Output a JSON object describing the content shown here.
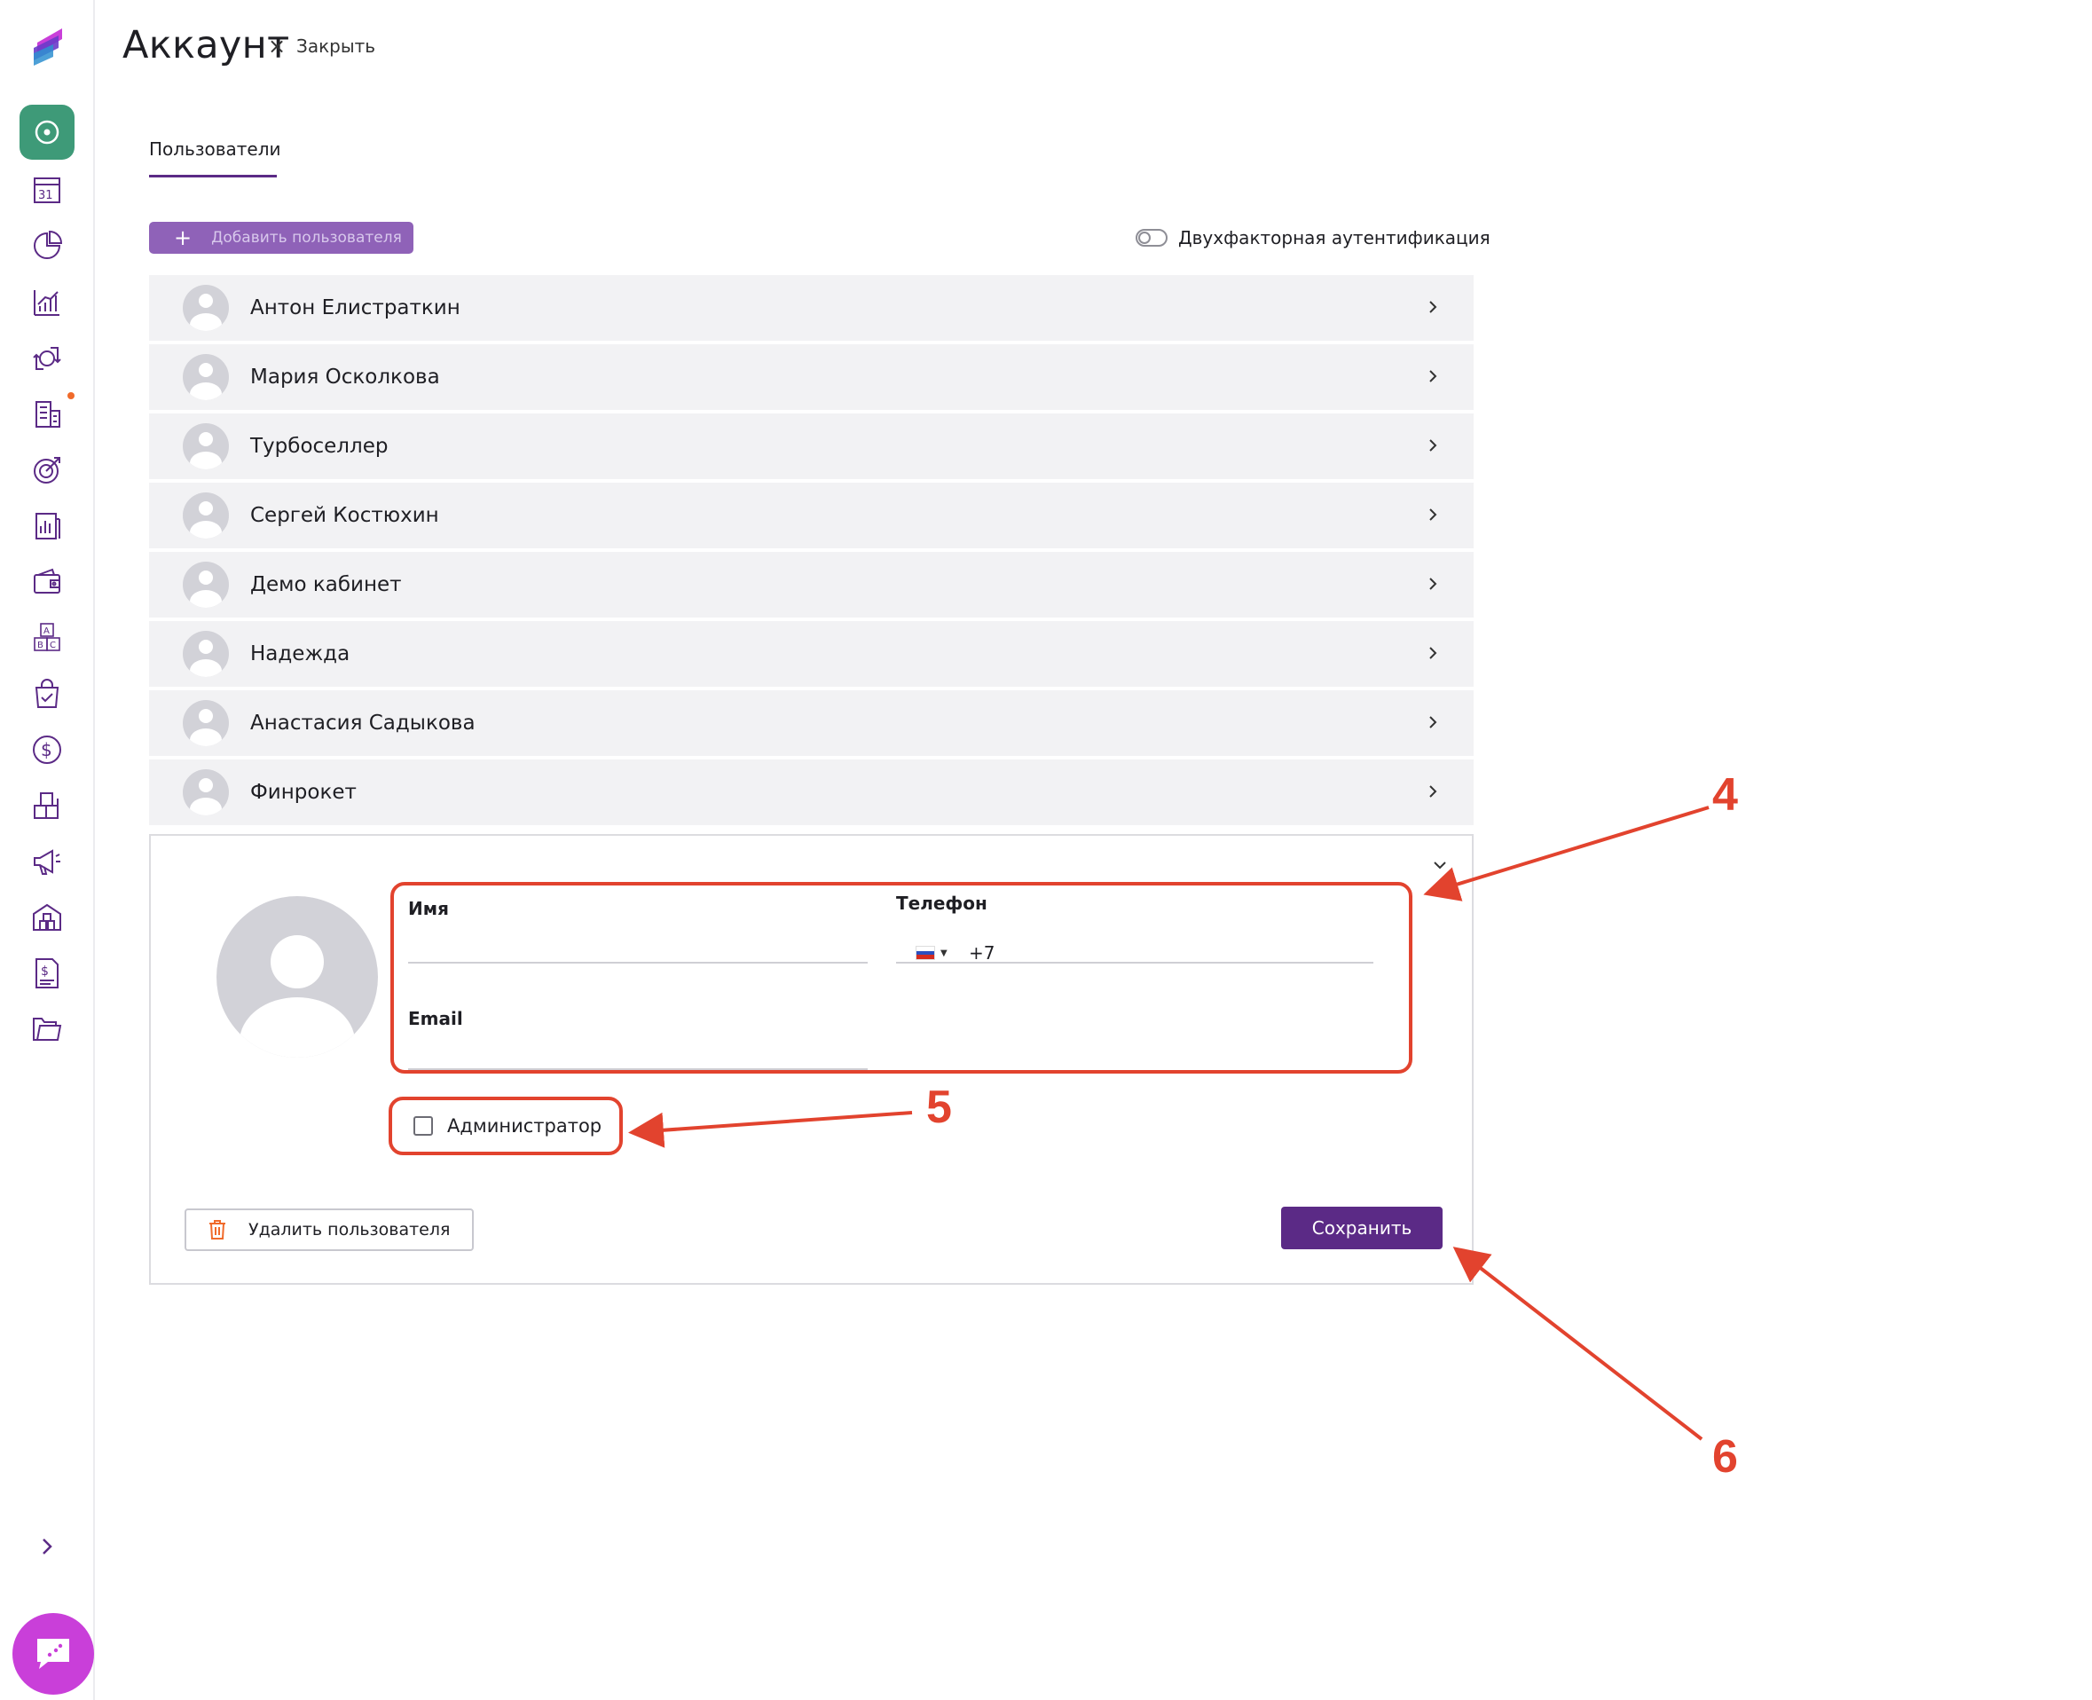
{
  "header": {
    "title": "Аккаунт",
    "close_icon": "×",
    "close_label": "Закрыть"
  },
  "tabs": [
    {
      "label": "Пользователи",
      "active": true
    }
  ],
  "toolbar": {
    "add_icon": "+",
    "add_user_label": "Добавить пользователя",
    "two_factor_label": "Двухфакторная аутентификация",
    "two_factor_enabled": false
  },
  "users": [
    {
      "name": "Антон Елистраткин"
    },
    {
      "name": "Мария Осколкова"
    },
    {
      "name": "Турбоселлер"
    },
    {
      "name": "Сергей Костюхин"
    },
    {
      "name": "Демо кабинет"
    },
    {
      "name": "Надежда"
    },
    {
      "name": "Анастасия Садыкова"
    },
    {
      "name": "Финрокет"
    }
  ],
  "new_user_form": {
    "name_label": "Имя",
    "name_value": "",
    "phone_label": "Телефон",
    "phone_prefix": "+7",
    "email_label": "Email",
    "email_value": "",
    "admin_label": "Администратор",
    "admin_checked": false,
    "delete_label": "Удалить пользователя",
    "save_label": "Сохранить"
  },
  "annotations": [
    {
      "number": "4"
    },
    {
      "number": "5"
    },
    {
      "number": "6"
    }
  ],
  "colors": {
    "accent": "#5b2a86",
    "add_button": "#8f62b8",
    "active_nav": "#3e9a78",
    "annotation": "#e2432e",
    "chat": "#c93fd9",
    "notification": "#f06a2a"
  },
  "sidebar": {
    "icons": [
      "logo-icon",
      "dashboard-icon",
      "calendar-icon",
      "pie-chart-icon",
      "bar-chart-icon",
      "exchange-icon",
      "building-icon",
      "target-icon",
      "report-icon",
      "wallet-icon",
      "abc-icon",
      "shopping-bag-icon",
      "dollar-icon",
      "boxes-icon",
      "megaphone-icon",
      "warehouse-icon",
      "invoice-icon",
      "folder-icon",
      "chevron-right-icon",
      "chat-icon"
    ]
  }
}
